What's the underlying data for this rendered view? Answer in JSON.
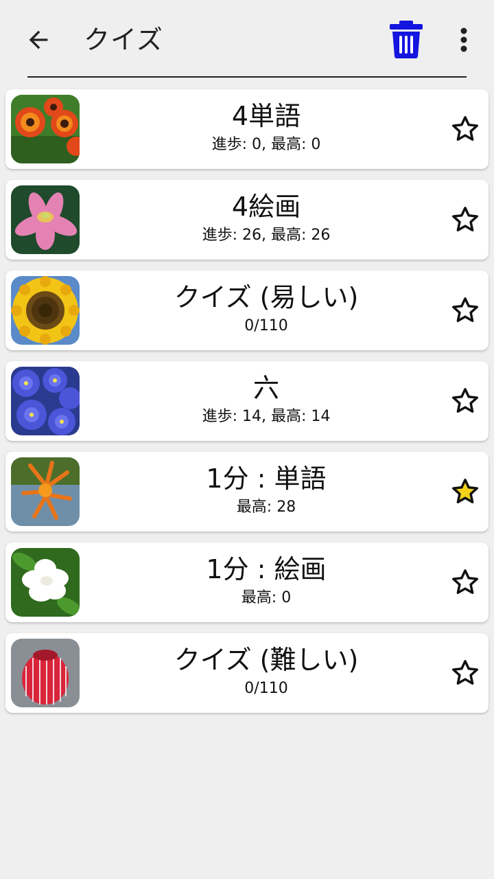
{
  "appbar": {
    "title": "クイズ",
    "back_icon": "arrow-back-icon",
    "trash_icon": "trash-icon",
    "more_icon": "more-vert-icon",
    "trash_color": "#1515e0"
  },
  "items": [
    {
      "title": "4単語",
      "subtitle": "進歩: 0, 最高: 0",
      "image": "red-helenium-flowers",
      "favorite": false
    },
    {
      "title": "4絵画",
      "subtitle": "進歩: 26, 最高: 26",
      "image": "pink-lotus-flower",
      "favorite": false
    },
    {
      "title": "クイズ (易しい)",
      "subtitle": "0/110",
      "image": "sunflower",
      "favorite": false
    },
    {
      "title": "六",
      "subtitle": "進歩: 14, 最高: 14",
      "image": "blue-pansies",
      "favorite": false
    },
    {
      "title": "1分 : 単語",
      "subtitle": "最高: 28",
      "image": "orange-tubular-flowers",
      "favorite": true
    },
    {
      "title": "1分 : 絵画",
      "subtitle": "最高: 0",
      "image": "white-gardenia",
      "favorite": false
    },
    {
      "title": "クイズ (難しい)",
      "subtitle": "0/110",
      "image": "red-banksia",
      "favorite": false
    }
  ],
  "colors": {
    "background": "#efefef",
    "card": "#ffffff",
    "star_filled": "#f2d31a"
  }
}
